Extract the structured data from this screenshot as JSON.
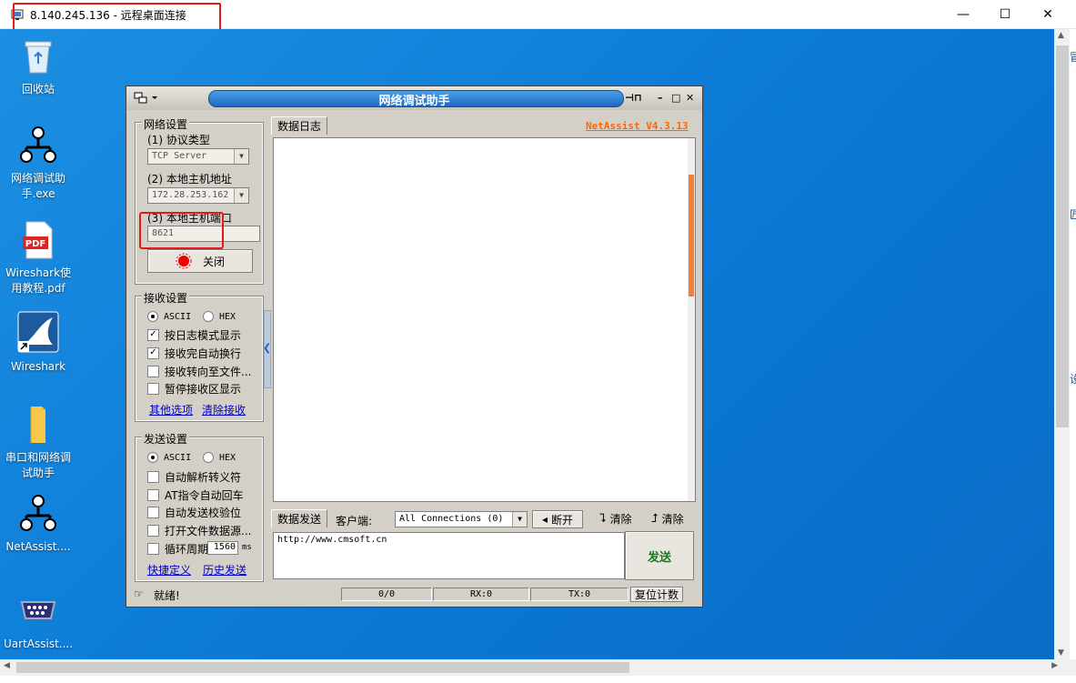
{
  "rdp": {
    "title": "8.140.245.136 - 远程桌面连接",
    "minimize": "—",
    "maximize": "☐",
    "close": "✕"
  },
  "desktop_icons": [
    {
      "label": "回收站",
      "icon": "recycle-bin-icon"
    },
    {
      "label": "网络调试助手.exe",
      "icon": "netassist-icon"
    },
    {
      "label": "Wireshark使用教程.pdf",
      "icon": "pdf-icon"
    },
    {
      "label": "Wireshark",
      "icon": "wireshark-icon"
    },
    {
      "label": "串口和网络调试助手",
      "icon": "folder-icon"
    },
    {
      "label": "NetAssist....",
      "icon": "netassist-icon"
    },
    {
      "label": "UartAssist....",
      "icon": "serial-port-icon"
    }
  ],
  "right_edge_chars": [
    "冒",
    "匠",
    "设"
  ],
  "netassist": {
    "title": "网络调试助手",
    "version_link": "NetAssist V4.3.13",
    "net_settings": {
      "group_title": "网络设置",
      "protocol_label": "(1) 协议类型",
      "protocol_value": "TCP Server",
      "host_label": "(2) 本地主机地址",
      "host_value": "172.28.253.162",
      "port_label": "(3) 本地主机端口",
      "port_value": "8621",
      "close_button": "关闭"
    },
    "recv_settings": {
      "group_title": "接收设置",
      "ascii": "ASCII",
      "hex": "HEX",
      "options": [
        {
          "label": "按日志模式显示",
          "checked": true
        },
        {
          "label": "接收完自动换行",
          "checked": true
        },
        {
          "label": "接收转向至文件...",
          "checked": false
        },
        {
          "label": "暂停接收区显示",
          "checked": false
        }
      ],
      "link_more": "其他选项",
      "link_clear": "清除接收"
    },
    "send_settings": {
      "group_title": "发送设置",
      "ascii": "ASCII",
      "hex": "HEX",
      "options": [
        {
          "label": "自动解析转义符",
          "checked": false
        },
        {
          "label": "AT指令自动回车",
          "checked": false
        },
        {
          "label": "自动发送校验位",
          "checked": false
        },
        {
          "label": "打开文件数据源...",
          "checked": false
        }
      ],
      "cycle_label": "循环周期",
      "cycle_value": "1560",
      "cycle_unit": "ms",
      "link_shortcut": "快捷定义",
      "link_history": "历史发送"
    },
    "log_tab": "数据日志",
    "send_tab": "数据发送",
    "client_label": "客户端:",
    "client_select": "All Connections (0)",
    "disconnect_button": "断开",
    "clear1_button": "清除",
    "clear2_button": "清除",
    "send_text": "http://www.cmsoft.cn",
    "send_button": "发送",
    "status": {
      "ready": "就绪!",
      "counter": "0/0",
      "rx": "RX:0",
      "tx": "TX:0",
      "reset_button": "复位计数"
    }
  }
}
